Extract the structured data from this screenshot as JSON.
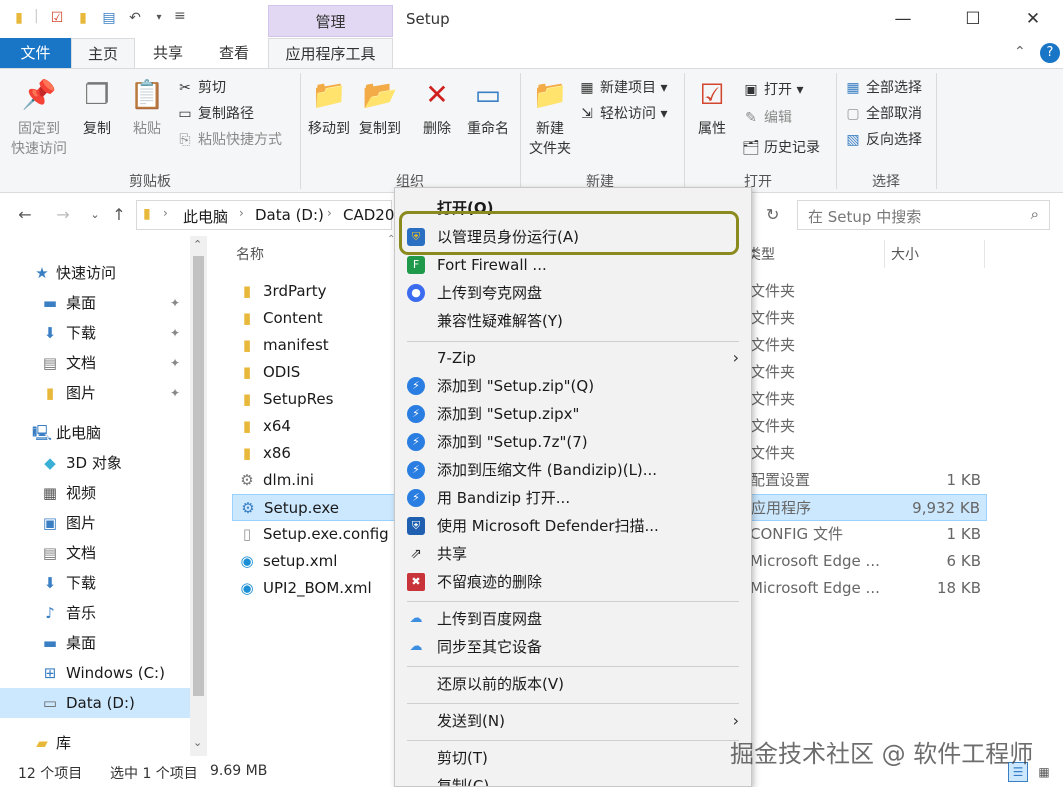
{
  "window": {
    "title": "Setup",
    "manage_tab": "管理",
    "minimize": "—",
    "maximize": "☐",
    "close": "✕"
  },
  "tabs": {
    "file": "文件",
    "home": "主页",
    "share": "共享",
    "view": "查看",
    "app_tools": "应用程序工具"
  },
  "ribbon": {
    "clipboard": {
      "label": "剪贴板",
      "pin_line1": "固定到",
      "pin_line2": "快速访问",
      "copy": "复制",
      "paste": "粘贴",
      "cut": "剪切",
      "copy_path": "复制路径",
      "paste_shortcut": "粘贴快捷方式"
    },
    "organize": {
      "label": "组织",
      "move_to": "移动到",
      "copy_to": "复制到",
      "delete": "删除",
      "rename": "重命名"
    },
    "new": {
      "label": "新建",
      "new_folder_line1": "新建",
      "new_folder_line2": "文件夹",
      "new_item": "新建项目",
      "easy_access": "轻松访问"
    },
    "open": {
      "label": "打开",
      "properties": "属性",
      "open": "打开",
      "edit": "编辑",
      "history": "历史记录"
    },
    "select": {
      "label": "选择",
      "select_all": "全部选择",
      "select_none": "全部取消",
      "invert": "反向选择"
    }
  },
  "address": {
    "crumbs": [
      "此电脑",
      "Data (D:)",
      "CAD20"
    ],
    "search_placeholder": "在 Setup 中搜索"
  },
  "sidebar": {
    "items": [
      {
        "label": "快速访问",
        "icon": "star-icon"
      },
      {
        "label": "桌面",
        "icon": "desktop-icon"
      },
      {
        "label": "下载",
        "icon": "download-icon"
      },
      {
        "label": "文档",
        "icon": "document-icon"
      },
      {
        "label": "图片",
        "icon": "picture-icon"
      },
      {
        "label": "此电脑",
        "icon": "computer-icon"
      },
      {
        "label": "3D 对象",
        "icon": "cube-icon"
      },
      {
        "label": "视频",
        "icon": "video-icon"
      },
      {
        "label": "图片",
        "icon": "picture-icon"
      },
      {
        "label": "文档",
        "icon": "document-icon"
      },
      {
        "label": "下载",
        "icon": "download-icon"
      },
      {
        "label": "音乐",
        "icon": "music-icon"
      },
      {
        "label": "桌面",
        "icon": "desktop-icon"
      },
      {
        "label": "Windows (C:)",
        "icon": "drive-icon"
      },
      {
        "label": "Data (D:)",
        "icon": "drive-icon"
      },
      {
        "label": "库",
        "icon": "library-icon"
      }
    ]
  },
  "filelist": {
    "col_name": "名称",
    "col_type": "类型",
    "col_size": "大小",
    "rows": [
      {
        "name": "3rdParty",
        "type": "文件夹",
        "size": "",
        "icon": "folder-icon"
      },
      {
        "name": "Content",
        "type": "文件夹",
        "size": "",
        "icon": "folder-icon"
      },
      {
        "name": "manifest",
        "type": "文件夹",
        "size": "",
        "icon": "folder-icon"
      },
      {
        "name": "ODIS",
        "type": "文件夹",
        "size": "",
        "icon": "folder-icon"
      },
      {
        "name": "SetupRes",
        "type": "文件夹",
        "size": "",
        "icon": "folder-icon"
      },
      {
        "name": "x64",
        "type": "文件夹",
        "size": "",
        "icon": "folder-icon"
      },
      {
        "name": "x86",
        "type": "文件夹",
        "size": "",
        "icon": "folder-icon"
      },
      {
        "name": "dlm.ini",
        "type": "配置设置",
        "size": "1 KB",
        "icon": "ini-file-icon"
      },
      {
        "name": "Setup.exe",
        "type": "应用程序",
        "size": "9,932 KB",
        "icon": "exe-file-icon"
      },
      {
        "name": "Setup.exe.config",
        "type": "CONFIG 文件",
        "size": "1 KB",
        "icon": "file-icon"
      },
      {
        "name": "setup.xml",
        "type": "Microsoft Edge ...",
        "size": "6 KB",
        "icon": "edge-icon"
      },
      {
        "name": "UPI2_BOM.xml",
        "type": "Microsoft Edge ...",
        "size": "18 KB",
        "icon": "edge-icon"
      }
    ]
  },
  "status": {
    "count": "12 个项目",
    "selected": "选中 1 个项目",
    "size": "9.69 MB"
  },
  "context_menu": {
    "items": [
      {
        "label": "打开(O)",
        "bold": true
      },
      {
        "label": "以管理员身份运行(A)",
        "icon": "shield-icon"
      },
      {
        "label": "Fort Firewall ...",
        "icon": "firewall-icon"
      },
      {
        "label": "上传到夸克网盘",
        "icon": "quark-icon"
      },
      {
        "label": "兼容性疑难解答(Y)"
      },
      {
        "label": "7-Zip",
        "submenu": true
      },
      {
        "label": "添加到 \"Setup.zip\"(Q)",
        "icon": "bandizip-icon"
      },
      {
        "label": "添加到 \"Setup.zipx\"",
        "icon": "bandizip-icon"
      },
      {
        "label": "添加到 \"Setup.7z\"(7)",
        "icon": "bandizip-icon"
      },
      {
        "label": "添加到压缩文件 (Bandizip)(L)...",
        "icon": "bandizip-icon"
      },
      {
        "label": "用 Bandizip 打开...",
        "icon": "bandizip-icon"
      },
      {
        "label": "使用 Microsoft Defender扫描...",
        "icon": "defender-icon"
      },
      {
        "label": "共享",
        "icon": "share-icon"
      },
      {
        "label": "不留痕迹的删除",
        "icon": "shred-icon"
      },
      {
        "label": "上传到百度网盘",
        "icon": "baidu-icon"
      },
      {
        "label": "同步至其它设备",
        "icon": "baidu-icon"
      },
      {
        "label": "还原以前的版本(V)"
      },
      {
        "label": "发送到(N)",
        "submenu": true
      },
      {
        "label": "剪切(T)"
      },
      {
        "label": "复制(C)"
      }
    ]
  },
  "watermark": "掘金技术社区 @ 软件工程师",
  "colors": {
    "accent": "#1975c5",
    "selection": "#cce8ff",
    "highlight_ring": "#8a8a1e",
    "manage_tab": "#e3d8f3"
  }
}
